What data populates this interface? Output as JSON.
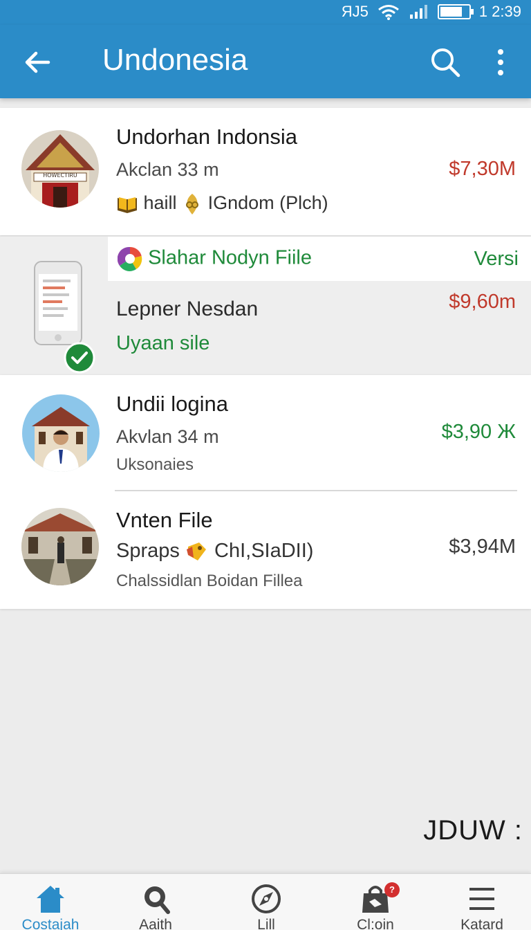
{
  "status_bar": {
    "signal_text": "ЯJ5",
    "time": "1 2:39"
  },
  "header": {
    "title": "Undonesia"
  },
  "list": [
    {
      "title": "Undorhan Indonsia",
      "subtitle": "Akclan 33 m",
      "meta_1": "haill",
      "meta_2": "IGndom (Plch)",
      "price": "$7,30M",
      "avatar_icon": "building-avatar",
      "avatar_sign": "HOWECTIRU"
    },
    {
      "top_label": "Slahar Nodyn Fiile",
      "top_right": "Versi",
      "title": "Lepner Nesdan",
      "subtitle": "Uyaan sile",
      "price": "$9,60m",
      "avatar_icon": "phone-check-avatar"
    },
    {
      "title": "Undii logina",
      "subtitle": "Akvlan 34 m",
      "detail": "Uksonaies",
      "price": "$3,90 Ж",
      "avatar_icon": "person-avatar"
    },
    {
      "title": "Vnten File",
      "subtitle_a": "Spraps",
      "subtitle_b": "ChI,SIaDII)",
      "detail": "Chalssidlan  Boidan Fillea",
      "price": "$3,94M",
      "avatar_icon": "house-avatar"
    }
  ],
  "corner_text": "JDUW :",
  "bottom_nav": [
    {
      "label": "Costajah",
      "icon": "home-icon",
      "active": true
    },
    {
      "label": "Aaith",
      "icon": "search-icon"
    },
    {
      "label": "Lill",
      "icon": "compass-icon"
    },
    {
      "label": "Cl:oin",
      "icon": "bag-icon",
      "badge": "?"
    },
    {
      "label": "Katard",
      "icon": "menu-icon"
    }
  ],
  "colors": {
    "primary": "#2b8cc8",
    "price_red": "#c0392b",
    "price_green": "#1f8a3a",
    "background": "#ececec"
  }
}
